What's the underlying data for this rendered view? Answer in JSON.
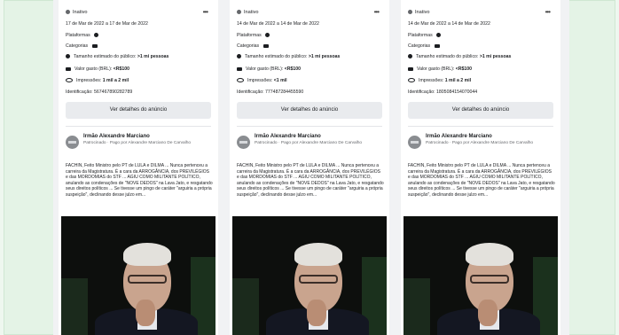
{
  "cards": [
    {
      "status": "Inativo",
      "more": "•••",
      "date_range": "17 de Mar de 2022 a 17 de Mar de 2022",
      "platforms_label": "Plataformas",
      "categories_label": "Categorias",
      "audience_label": "Tamanho estimado do público:",
      "audience_value": ">1 mi pessoas",
      "spend_label": "Valor gasto (BRL):",
      "spend_value": "<R$100",
      "impressions_label": "Impressões:",
      "impressions_value": "1 mil a 2 mil",
      "id_label": "Identificação:",
      "id_value": "567467890282789",
      "details_button": "Ver detalhes do anúncio",
      "page_name": "Irmão Alexandre Marciano",
      "sponsored_line": "Patrocinado · Pago por Alexandre Marciano De Carvalho",
      "ad_text": "FACHIN, Feito Ministro pelo PT de LULA e DILMA ... Nunca pertenceu a carreira da Magistratura. É a cara da ARROGÂNCIA, dos PREVILÉGIOS e das MORDOMIAS do STF ... AGIU COMO MILITANTE POLÍTICO, anulando as condenações de \"NOVE DEDOS\" na Lava Jato, e resgatando seus direitos políticos ... Se tivesse um pingo de caráter \"arguiria a própria suspeição\", declinando desse julzo em..."
    },
    {
      "status": "Inativo",
      "more": "•••",
      "date_range": "14 de Mar de 2022 a 14 de Mar de 2022",
      "platforms_label": "Plataformas",
      "categories_label": "Categorias",
      "audience_label": "Tamanho estimado do público:",
      "audience_value": ">1 mi pessoas",
      "spend_label": "Valor gasto (BRL):",
      "spend_value": "<R$100",
      "impressions_label": "Impressões:",
      "impressions_value": "<1 mil",
      "id_label": "Identificação:",
      "id_value": "777487284455590",
      "details_button": "Ver detalhes do anúncio",
      "page_name": "Irmão Alexandre Marciano",
      "sponsored_line": "Patrocinado · Pago por Alexandre Marciano De Carvalho",
      "ad_text": "FACHIN, Feito Ministro pelo PT de LULA e DILMA ... Nunca pertenceu a carreira da Magistratura. É a cara da ARROGÂNCIA, dos PREVILÉGIOS e das MORDOMIAS do STF ... AGIU COMO MILITANTE POLÍTICO, anulando as condenações de \"NOVE DEDOS\" na Lava Jato, e resgatando seus direitos políticos ... Se tivesse um pingo de caráter \"arguiria a própria suspeição\", declinando desse julzo em..."
    },
    {
      "status": "Inativo",
      "more": "•••",
      "date_range": "14 de Mar de 2022 a 14 de Mar de 2022",
      "platforms_label": "Plataformas",
      "categories_label": "Categorias",
      "audience_label": "Tamanho estimado do público:",
      "audience_value": ">1 mi pessoas",
      "spend_label": "Valor gasto (BRL):",
      "spend_value": "<R$100",
      "impressions_label": "Impressões:",
      "impressions_value": "1 mil a 2 mil",
      "id_label": "Identificação:",
      "id_value": "1805084154070044",
      "details_button": "Ver detalhes do anúncio",
      "page_name": "Irmão Alexandre Marciano",
      "sponsored_line": "Patrocinado · Pago por Alexandre Marciano De Carvalho",
      "ad_text": "FACHIN, Feito Ministro pelo PT de LULA e DILMA ... Nunca pertenceu a carreira da Magistratura. É a cara da ARROGÂNCIA, dos PREVILÉGIOS e das MORDOMIAS do STF ... AGIU COMO MILITANTE POLÍTICO, anulando as condenações de \"NOVE DEDOS\" na Lava Jato, e resgatando seus direitos políticos ... Se tivesse um pingo de caráter \"arguiria a própria suspeição\", declinando desse julzo em..."
    }
  ]
}
